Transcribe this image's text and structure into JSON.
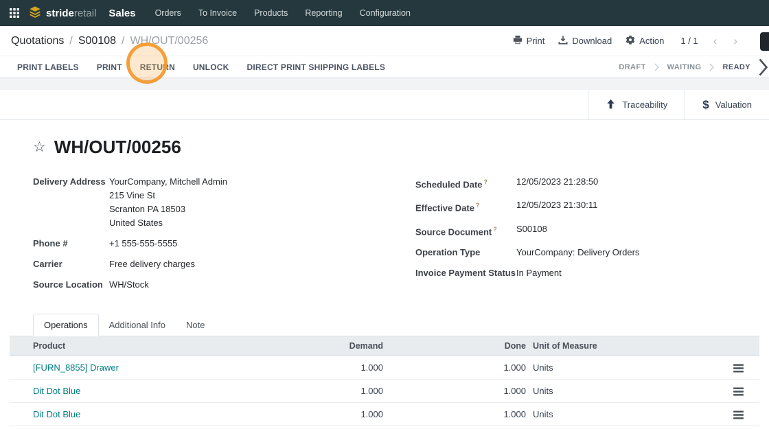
{
  "colors": {
    "navbar_bg": "#24383d",
    "logo_gold": "#d9a521",
    "link_teal": "#017e84",
    "annotation_orange": "#f29b38"
  },
  "navbar": {
    "logo_bold": "stride",
    "logo_light": "retail",
    "app_name": "Sales",
    "menu_items": [
      "Orders",
      "To Invoice",
      "Products",
      "Reporting",
      "Configuration"
    ]
  },
  "breadcrumb": {
    "items": [
      "Quotations",
      "S00108",
      "WH/OUT/00256"
    ],
    "separator": "/",
    "actions": {
      "print": "Print",
      "download": "Download",
      "action": "Action"
    },
    "pager": "1 / 1",
    "pager_prev": "‹",
    "pager_next": "›"
  },
  "action_bar": {
    "buttons": {
      "print_labels": "PRINT LABELS",
      "print": "PRINT",
      "return": "RETURN",
      "unlock": "UNLOCK",
      "direct_print": "DIRECT PRINT SHIPPING LABELS"
    },
    "statuses": [
      "DRAFT",
      "WAITING",
      "READY"
    ]
  },
  "sheet": {
    "stat_buttons": {
      "traceability": "Traceability",
      "valuation": "Valuation",
      "valuation_icon": "$"
    },
    "star": "☆",
    "title": "WH/OUT/00256",
    "fields_left": {
      "delivery_address": {
        "label": "Delivery Address",
        "lines": [
          "YourCompany, Mitchell Admin",
          "215 Vine St",
          "Scranton PA 18503",
          "United States"
        ]
      },
      "phone": {
        "label": "Phone #",
        "value": "+1 555-555-5555"
      },
      "carrier": {
        "label": "Carrier",
        "value": "Free delivery charges"
      },
      "source_location": {
        "label": "Source Location",
        "value": "WH/Stock"
      }
    },
    "fields_right": {
      "scheduled_date": {
        "label": "Scheduled Date",
        "help": "?",
        "value": "12/05/2023 21:28:50"
      },
      "effective_date": {
        "label": "Effective Date",
        "help": "?",
        "value": "12/05/2023 21:30:11"
      },
      "source_document": {
        "label": "Source Document",
        "help": "?",
        "value": "S00108"
      },
      "operation_type": {
        "label": "Operation Type",
        "value": "YourCompany: Delivery Orders"
      },
      "invoice_payment_status": {
        "label": "Invoice Payment Status",
        "value": "In Payment"
      }
    },
    "tabs": [
      "Operations",
      "Additional Info",
      "Note"
    ],
    "table": {
      "columns": [
        "Product",
        "Demand",
        "Done",
        "Unit of Measure"
      ],
      "rows": [
        {
          "product": "[FURN_8855] Drawer",
          "demand": "1.000",
          "done": "1.000",
          "uom": "Units"
        },
        {
          "product": "Dit Dot Blue",
          "demand": "1.000",
          "done": "1.000",
          "uom": "Units"
        },
        {
          "product": "Dit Dot Blue",
          "demand": "1.000",
          "done": "1.000",
          "uom": "Units"
        }
      ]
    }
  }
}
